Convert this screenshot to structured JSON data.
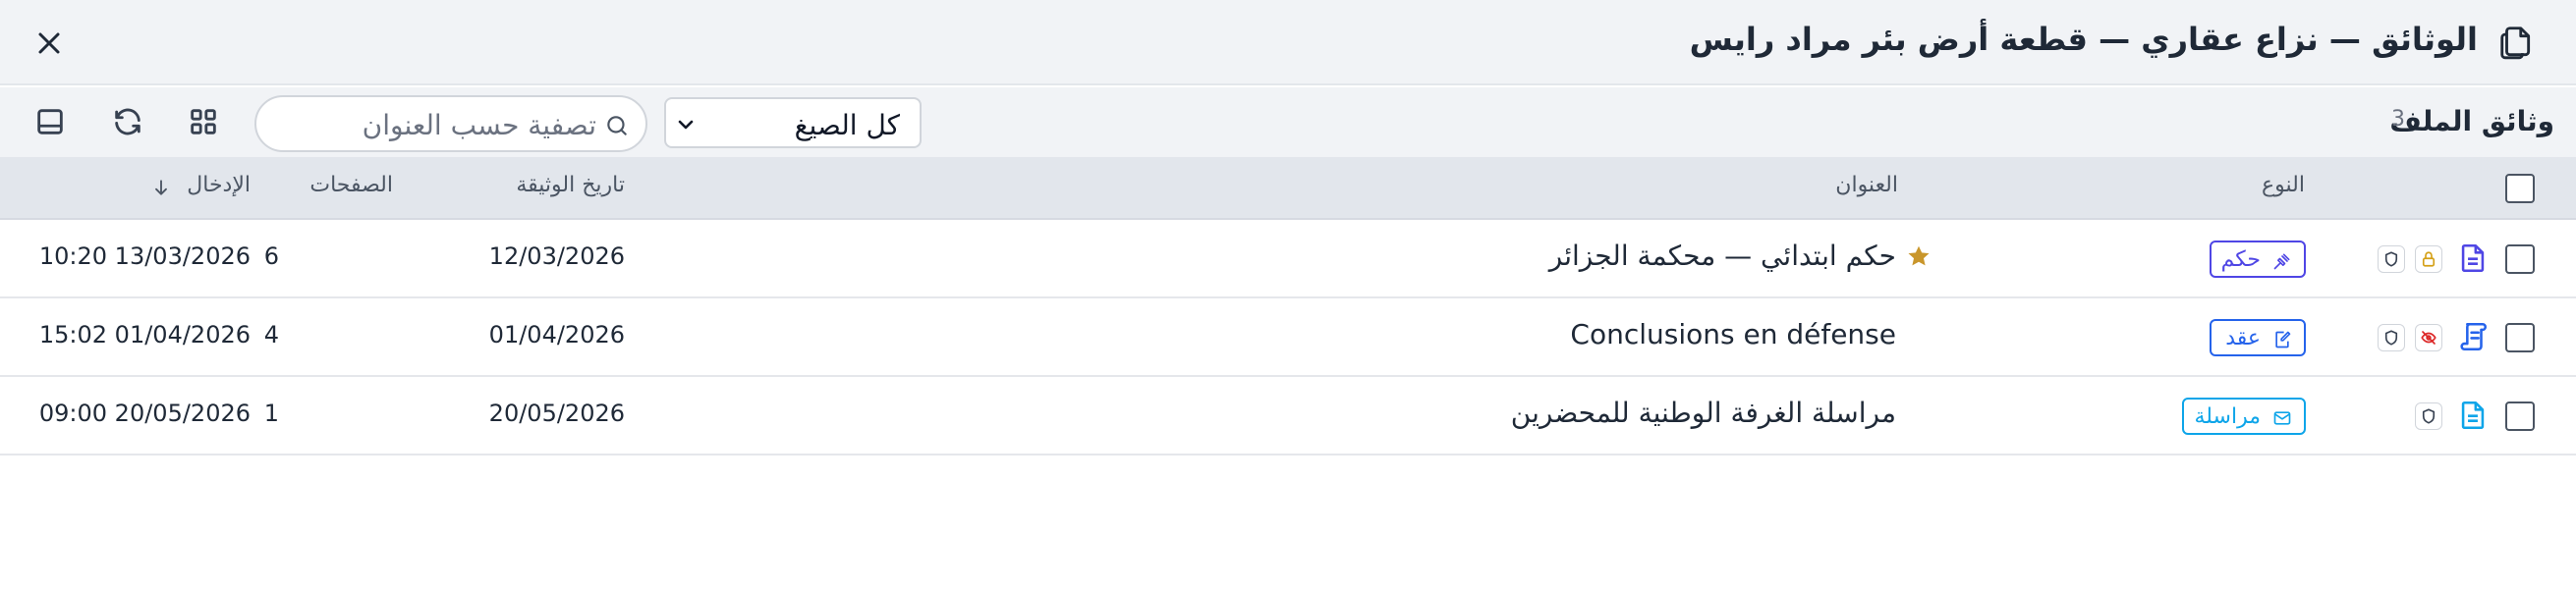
{
  "header": {
    "title": "الوثائق — نزاع عقاري — قطعة أرض بئر مراد رايس",
    "title_icon": "documents-icon",
    "close_icon": "close-icon"
  },
  "toolbar": {
    "label": "وثائق الملف",
    "count": "3",
    "filter_select": {
      "value": "كل الصيغ"
    },
    "search": {
      "placeholder": "تصفية حسب العنوان",
      "value": ""
    },
    "buttons": [
      "refresh-icon",
      "grid-view-icon",
      "panel-toggle-icon"
    ]
  },
  "table": {
    "columns": {
      "type": "النوع",
      "title": "العنوان",
      "doc_date": "تاريخ الوثيقة",
      "pages": "الصفحات",
      "entry": "الإدخال"
    },
    "sort": {
      "column": "entry",
      "direction": "desc",
      "icon": "arrow-down-icon"
    },
    "rows": [
      {
        "type_label": "حكم",
        "type_icon": "gavel-icon",
        "title": "حكم ابتدائي — محكمة الجزائر",
        "starred": true,
        "locked": true,
        "hidden": false,
        "doc_date": "12/03/2026",
        "pages": "6",
        "entry": "13/03/2026 10:20"
      },
      {
        "type_label": "عقد",
        "type_icon": "contract-edit-icon",
        "title": "Conclusions en défense",
        "starred": false,
        "locked": false,
        "hidden": true,
        "doc_date": "01/04/2026",
        "pages": "4",
        "entry": "01/04/2026 15:02"
      },
      {
        "type_label": "مراسلة",
        "type_icon": "mail-icon",
        "title": "مراسلة الغرفة الوطنية للمحضرين",
        "starred": false,
        "locked": false,
        "hidden": false,
        "doc_date": "20/05/2026",
        "pages": "1",
        "entry": "20/05/2026 09:00"
      }
    ]
  },
  "colors": {
    "header_bg": "#f1f3f6",
    "table_header_bg": "#e2e6ec",
    "verdict": "#4f46e5",
    "contract": "#2563eb",
    "mail": "#0ea5e9",
    "star": "#c9962b",
    "lock": "#d4a017",
    "hidden": "#dc2626"
  }
}
